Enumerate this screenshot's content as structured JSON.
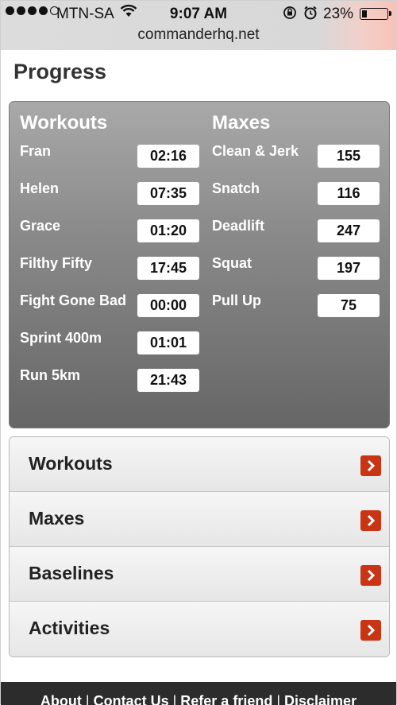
{
  "status": {
    "carrier": "MTN-SA",
    "time": "9:07 AM",
    "battery_pct": "23%",
    "battery_level": 0.23,
    "url": "commanderhq.net"
  },
  "page": {
    "title": "Progress"
  },
  "progress": {
    "workouts_title": "Workouts",
    "maxes_title": "Maxes",
    "workouts": [
      {
        "name": "Fran",
        "value": "02:16"
      },
      {
        "name": "Helen",
        "value": "07:35"
      },
      {
        "name": "Grace",
        "value": "01:20"
      },
      {
        "name": "Filthy Fifty",
        "value": "17:45"
      },
      {
        "name": "Fight Gone Bad",
        "value": "00:00"
      },
      {
        "name": "Sprint 400m",
        "value": "01:01"
      },
      {
        "name": "Run 5km",
        "value": "21:43"
      }
    ],
    "maxes": [
      {
        "name": "Clean & Jerk",
        "value": "155"
      },
      {
        "name": "Snatch",
        "value": "116"
      },
      {
        "name": "Deadlift",
        "value": "247"
      },
      {
        "name": "Squat",
        "value": "197"
      },
      {
        "name": "Pull Up",
        "value": "75"
      }
    ]
  },
  "menu": [
    {
      "label": "Workouts",
      "icon": "chevron-right-icon"
    },
    {
      "label": "Maxes",
      "icon": "chevron-right-icon"
    },
    {
      "label": "Baselines",
      "icon": "chevron-right-icon"
    },
    {
      "label": "Activities",
      "icon": "chevron-right-icon"
    }
  ],
  "footer": {
    "links": [
      "About",
      "Contact Us",
      "Refer a friend",
      "Disclaimer"
    ]
  },
  "colors": {
    "accent": "#c83414",
    "panel_top": "#a9a9a9",
    "panel_bottom": "#666666",
    "footer_bg": "#2c2c2c"
  }
}
